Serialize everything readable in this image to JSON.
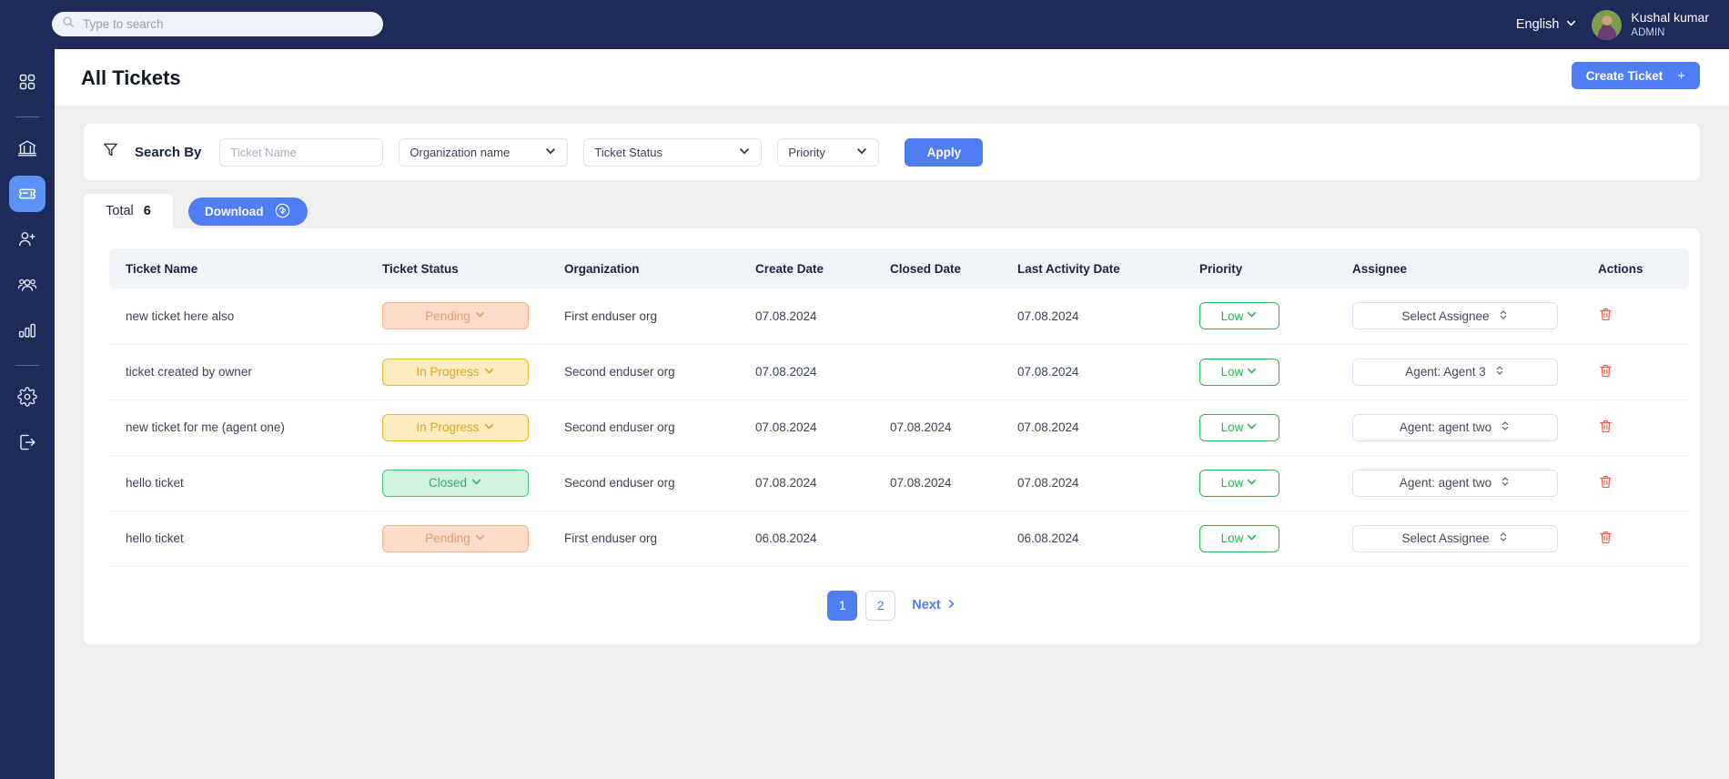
{
  "topbar": {
    "search_placeholder": "Type to search",
    "search_value": "",
    "language": "English",
    "user_name": "Kushal kumar",
    "user_role": "ADMIN"
  },
  "header": {
    "title": "All Tickets",
    "create_button": "Create Ticket",
    "create_plus": "+"
  },
  "filters": {
    "label": "Search By",
    "ticket_name_placeholder": "Ticket Name",
    "ticket_name_value": "",
    "organization_selected": "Organization name",
    "status_selected": "Ticket Status",
    "priority_selected": "Priority",
    "apply_label": "Apply"
  },
  "summary": {
    "total_label": "Total",
    "total_value": "6",
    "download_label": "Download"
  },
  "table": {
    "columns": [
      "Ticket Name",
      "Ticket Status",
      "Organization",
      "Create Date",
      "Closed Date",
      "Last Activity Date",
      "Priority",
      "Assignee",
      "Actions"
    ],
    "rows": [
      {
        "name": "new ticket here also",
        "status": "Pending",
        "status_kind": "pending",
        "organization": "First enduser org",
        "create_date": "07.08.2024",
        "closed_date": "",
        "last_activity_date": "07.08.2024",
        "priority": "Low",
        "assignee": "Select Assignee"
      },
      {
        "name": "ticket created by owner",
        "status": "In Progress",
        "status_kind": "inprogress",
        "organization": "Second enduser org",
        "create_date": "07.08.2024",
        "closed_date": "",
        "last_activity_date": "07.08.2024",
        "priority": "Low",
        "assignee": "Agent: Agent 3"
      },
      {
        "name": "new ticket for me (agent one)",
        "status": "In Progress",
        "status_kind": "inprogress",
        "organization": "Second enduser org",
        "create_date": "07.08.2024",
        "closed_date": "07.08.2024",
        "last_activity_date": "07.08.2024",
        "priority": "Low",
        "assignee": "Agent: agent two"
      },
      {
        "name": "hello ticket",
        "status": "Closed",
        "status_kind": "closed",
        "organization": "Second enduser org",
        "create_date": "07.08.2024",
        "closed_date": "07.08.2024",
        "last_activity_date": "07.08.2024",
        "priority": "Low",
        "assignee": "Agent: agent two"
      },
      {
        "name": "hello ticket",
        "status": "Pending",
        "status_kind": "pending",
        "organization": "First enduser org",
        "create_date": "06.08.2024",
        "closed_date": "",
        "last_activity_date": "06.08.2024",
        "priority": "Low",
        "assignee": "Select Assignee"
      }
    ]
  },
  "pagination": {
    "pages": [
      "1",
      "2"
    ],
    "active_page": "1",
    "next_label": "Next"
  },
  "sidebar": {
    "items": [
      {
        "icon": "grid-icon",
        "name": "dashboard",
        "active": false
      },
      {
        "icon": "bank-icon",
        "name": "organizations",
        "active": false
      },
      {
        "icon": "ticket-icon",
        "name": "tickets",
        "active": true
      },
      {
        "icon": "add-user-icon",
        "name": "add-user",
        "active": false
      },
      {
        "icon": "users-icon",
        "name": "users",
        "active": false
      },
      {
        "icon": "bar-chart-icon",
        "name": "reports",
        "active": false
      },
      {
        "icon": "gear-icon",
        "name": "settings",
        "active": false
      },
      {
        "icon": "logout-icon",
        "name": "logout",
        "active": false
      }
    ]
  },
  "colors": {
    "sidebar_bg": "#1E2A5A",
    "accent_blue": "#4F7DF3",
    "active_item": "#5B93F5",
    "page_bg": "#EFEFEF",
    "pending": "#EE9A6A",
    "in_progress": "#E0A52A",
    "closed": "#3DAE6B",
    "priority_low": "#2DB84B",
    "delete": "#F05A4A"
  }
}
